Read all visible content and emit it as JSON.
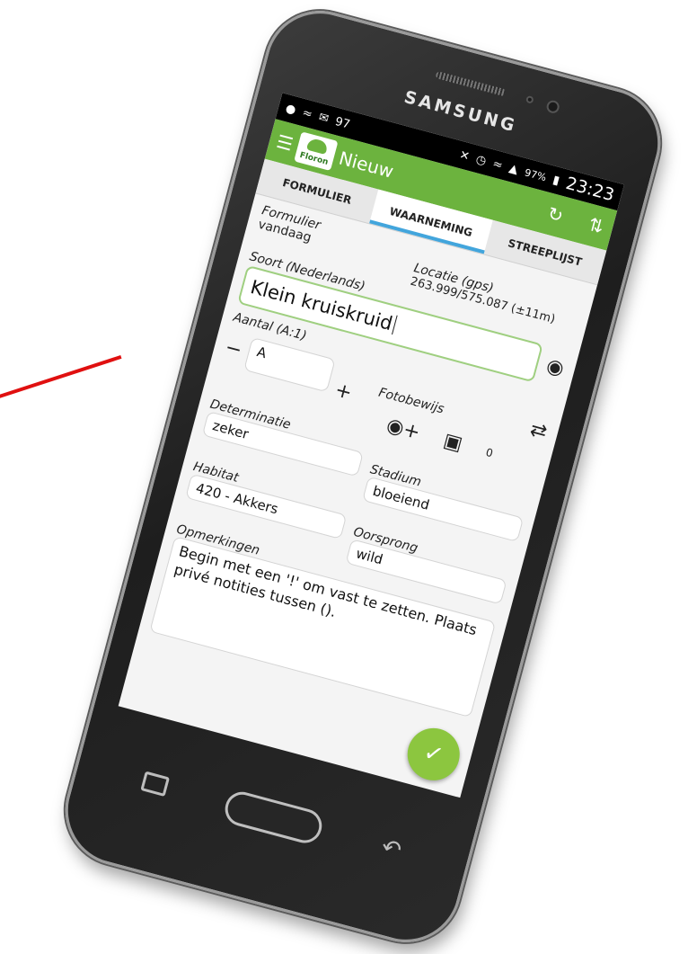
{
  "status": {
    "location_icon": "location-pin-icon",
    "cast_icon": "cast-icon",
    "mail_icon": "mail-icon",
    "notification_count": "97",
    "mute_icon": "mute-icon",
    "alarm_icon": "alarm-icon",
    "wifi_icon": "wifi-icon",
    "signal_icon": "signal-icon",
    "battery": "97%",
    "battery_icon": "battery-icon",
    "time": "23:23"
  },
  "device": {
    "brand": "SAMSUNG"
  },
  "appbar": {
    "menu_icon": "hamburger-icon",
    "logo_text": "Floron",
    "title": "Nieuw",
    "refresh_icon": "refresh-icon",
    "collapse_icon": "collapse-icon"
  },
  "tabs": [
    {
      "label": "FORMULIER",
      "active": false
    },
    {
      "label": "WAARNEMING",
      "active": true
    },
    {
      "label": "STREEPLIJST",
      "active": false
    }
  ],
  "form": {
    "formulier_label": "Formulier",
    "formulier_value": "vandaag",
    "locatie_label": "Locatie (gps)",
    "locatie_value": "263.999/575.087 (±11m)",
    "soort_label": "Soort (Nederlands)",
    "soort_value": "Klein kruiskruid",
    "aantal_label": "Aantal (A:1)",
    "aantal_value": "A",
    "aantal_minus": "−",
    "aantal_plus": "+",
    "fotobewijs_label": "Fotobewijs",
    "photo_count": "0",
    "determinatie_label": "Determinatie",
    "determinatie_value": "zeker",
    "stadium_label": "Stadium",
    "stadium_value": "bloeiend",
    "habitat_label": "Habitat",
    "habitat_value": "420 - Akkers",
    "oorsprong_label": "Oorsprong",
    "oorsprong_value": "wild",
    "opmerkingen_label": "Opmerkingen",
    "opmerkingen_placeholder": "Begin met een '!' om vast te zetten. Plaats privé notities tussen ()."
  },
  "colors": {
    "appbar": "#6cb33e",
    "tab_indicator": "#42a5dc",
    "fab": "#8cc63f",
    "species_border": "#9fcf80",
    "annotation_line": "#e01010"
  }
}
